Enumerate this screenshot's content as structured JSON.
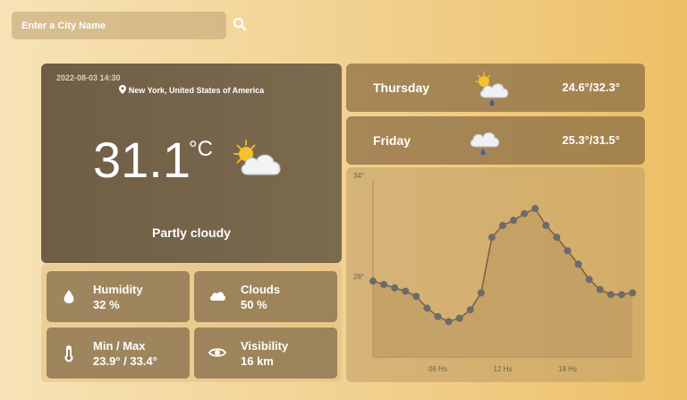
{
  "search": {
    "placeholder": "Enter a City Name"
  },
  "current": {
    "datetime": "2022-08-03 14:30",
    "location": "New York, United States of America",
    "temperature": "31.1",
    "unit": "°C",
    "condition": "Partly cloudy",
    "icon": "partly-cloudy-icon"
  },
  "stats": [
    {
      "icon": "humidity-drop-icon",
      "label": "Humidity",
      "value": "32 %"
    },
    {
      "icon": "cloud-icon",
      "label": "Clouds",
      "value": "50 %"
    },
    {
      "icon": "thermometer-icon",
      "label": "Min / Max",
      "value": "23.9° / 33.4°"
    },
    {
      "icon": "eye-icon",
      "label": "Visibility",
      "value": "16 km"
    }
  ],
  "forecast": [
    {
      "day": "Thursday",
      "icon": "sun-cloud-rain-icon",
      "temps": "24.6°/32.3°"
    },
    {
      "day": "Friday",
      "icon": "cloud-rain-icon",
      "temps": "25.3°/31.5°"
    }
  ],
  "colors": {
    "line": "#7a6448",
    "point": "#6b6b6b",
    "fill": "#b8955f"
  },
  "chart_data": {
    "type": "area",
    "x": [
      0,
      1,
      2,
      3,
      4,
      5,
      6,
      7,
      8,
      9,
      10,
      11,
      12,
      13,
      14,
      15,
      16,
      17,
      18,
      19,
      20,
      21,
      22,
      23,
      24
    ],
    "y": [
      28.0,
      27.8,
      27.6,
      27.4,
      27.1,
      26.4,
      25.9,
      25.6,
      25.8,
      26.3,
      27.3,
      30.6,
      31.3,
      31.6,
      32.0,
      32.3,
      31.3,
      30.6,
      29.8,
      29.0,
      28.1,
      27.5,
      27.2,
      27.2,
      27.3
    ],
    "y_ticks": [
      {
        "value": 34,
        "label": "34°"
      },
      {
        "value": 28,
        "label": "28°"
      }
    ],
    "x_ticks": [
      {
        "value": 6,
        "label": "06 Hs"
      },
      {
        "value": 12,
        "label": "12 Hs"
      },
      {
        "value": 18,
        "label": "18 Hs"
      }
    ],
    "ylim": [
      23.5,
      34
    ],
    "xlim": [
      0,
      24
    ]
  }
}
